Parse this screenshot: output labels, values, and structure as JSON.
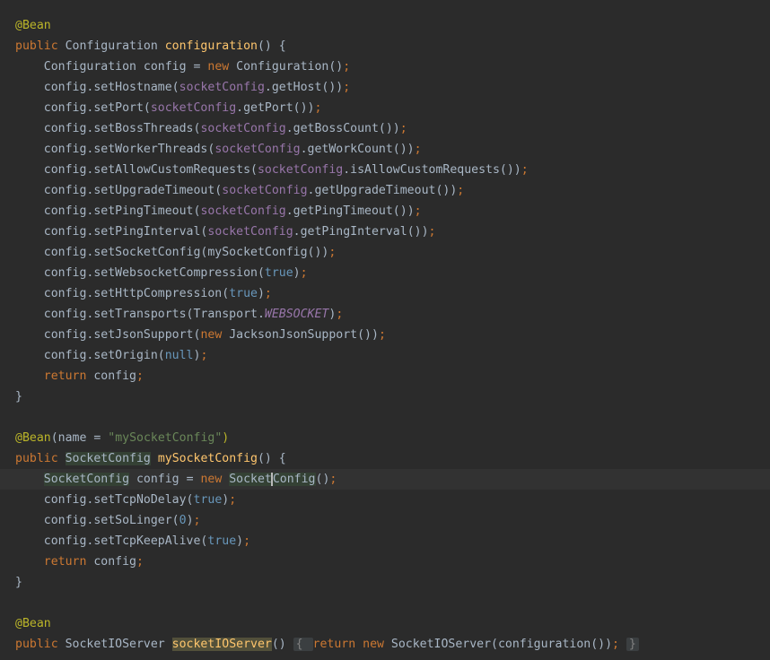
{
  "editor": {
    "lines": [
      [
        {
          "t": "@Bean",
          "c": "ann"
        }
      ],
      [
        {
          "t": "public ",
          "c": "kw"
        },
        {
          "t": "Configuration ",
          "c": "plain"
        },
        {
          "t": "configuration",
          "c": "fn"
        },
        {
          "t": "() {",
          "c": "plain"
        }
      ],
      [
        {
          "t": "    Configuration config = ",
          "c": "plain"
        },
        {
          "t": "new ",
          "c": "kw"
        },
        {
          "t": "Configuration",
          "c": "plain"
        },
        {
          "t": "()",
          "c": "plain"
        },
        {
          "t": ";",
          "c": "kw"
        }
      ],
      [
        {
          "t": "    config.setHostname(",
          "c": "plain"
        },
        {
          "t": "socketConfig",
          "c": "fld"
        },
        {
          "t": ".getHost())",
          "c": "plain"
        },
        {
          "t": ";",
          "c": "kw"
        }
      ],
      [
        {
          "t": "    config.setPort(",
          "c": "plain"
        },
        {
          "t": "socketConfig",
          "c": "fld"
        },
        {
          "t": ".getPort())",
          "c": "plain"
        },
        {
          "t": ";",
          "c": "kw"
        }
      ],
      [
        {
          "t": "    config.setBossThreads(",
          "c": "plain"
        },
        {
          "t": "socketConfig",
          "c": "fld"
        },
        {
          "t": ".getBossCount())",
          "c": "plain"
        },
        {
          "t": ";",
          "c": "kw"
        }
      ],
      [
        {
          "t": "    config.setWorkerThreads(",
          "c": "plain"
        },
        {
          "t": "socketConfig",
          "c": "fld"
        },
        {
          "t": ".getWorkCount())",
          "c": "plain"
        },
        {
          "t": ";",
          "c": "kw"
        }
      ],
      [
        {
          "t": "    config.setAllowCustomRequests(",
          "c": "plain"
        },
        {
          "t": "socketConfig",
          "c": "fld"
        },
        {
          "t": ".isAllowCustomRequests())",
          "c": "plain"
        },
        {
          "t": ";",
          "c": "kw"
        }
      ],
      [
        {
          "t": "    config.setUpgradeTimeout(",
          "c": "plain"
        },
        {
          "t": "socketConfig",
          "c": "fld"
        },
        {
          "t": ".getUpgradeTimeout())",
          "c": "plain"
        },
        {
          "t": ";",
          "c": "kw"
        }
      ],
      [
        {
          "t": "    config.setPingTimeout(",
          "c": "plain"
        },
        {
          "t": "socketConfig",
          "c": "fld"
        },
        {
          "t": ".getPingTimeout())",
          "c": "plain"
        },
        {
          "t": ";",
          "c": "kw"
        }
      ],
      [
        {
          "t": "    config.setPingInterval(",
          "c": "plain"
        },
        {
          "t": "socketConfig",
          "c": "fld"
        },
        {
          "t": ".getPingInterval())",
          "c": "plain"
        },
        {
          "t": ";",
          "c": "kw"
        }
      ],
      [
        {
          "t": "    config.setSocketConfig(mySocketConfig())",
          "c": "plain"
        },
        {
          "t": ";",
          "c": "kw"
        }
      ],
      [
        {
          "t": "    config.setWebsocketCompression(",
          "c": "plain"
        },
        {
          "t": "true",
          "c": "lit"
        },
        {
          "t": ")",
          "c": "plain"
        },
        {
          "t": ";",
          "c": "kw"
        }
      ],
      [
        {
          "t": "    config.setHttpCompression(",
          "c": "plain"
        },
        {
          "t": "true",
          "c": "lit"
        },
        {
          "t": ")",
          "c": "plain"
        },
        {
          "t": ";",
          "c": "kw"
        }
      ],
      [
        {
          "t": "    config.setTransports(Transport.",
          "c": "plain"
        },
        {
          "t": "WEBSOCKET",
          "c": "const"
        },
        {
          "t": ")",
          "c": "plain"
        },
        {
          "t": ";",
          "c": "kw"
        }
      ],
      [
        {
          "t": "    config.setJsonSupport(",
          "c": "plain"
        },
        {
          "t": "new ",
          "c": "kw"
        },
        {
          "t": "JacksonJsonSupport())",
          "c": "plain"
        },
        {
          "t": ";",
          "c": "kw"
        }
      ],
      [
        {
          "t": "    config.setOrigin(",
          "c": "plain"
        },
        {
          "t": "null",
          "c": "lit"
        },
        {
          "t": ")",
          "c": "plain"
        },
        {
          "t": ";",
          "c": "kw"
        }
      ],
      [
        {
          "t": "    ",
          "c": "plain"
        },
        {
          "t": "return ",
          "c": "kw"
        },
        {
          "t": "config",
          "c": "plain"
        },
        {
          "t": ";",
          "c": "kw"
        }
      ],
      [
        {
          "t": "}",
          "c": "plain"
        }
      ],
      [],
      [
        {
          "t": "@Bean",
          "c": "ann"
        },
        {
          "t": "(",
          "c": "plain"
        },
        {
          "t": "name",
          "c": "plain"
        },
        {
          "t": " = ",
          "c": "plain"
        },
        {
          "t": "\"mySocketConfig\"",
          "c": "str"
        },
        {
          "t": ")",
          "c": "ann"
        }
      ],
      [
        {
          "t": "public ",
          "c": "kw"
        },
        {
          "t": "SocketConfig",
          "c": "plain",
          "h": "green"
        },
        {
          "t": " ",
          "c": "plain"
        },
        {
          "t": "mySocketConfig",
          "c": "fn"
        },
        {
          "t": "() {",
          "c": "plain"
        }
      ],
      [
        {
          "t": "    ",
          "c": "plain"
        },
        {
          "t": "SocketConfig",
          "c": "plain",
          "h": "green"
        },
        {
          "t": " config = ",
          "c": "plain"
        },
        {
          "t": "new ",
          "c": "kw"
        },
        {
          "t": "Socket",
          "c": "plain",
          "h": "green"
        },
        {
          "t": "",
          "c": "plain",
          "caret": true
        },
        {
          "t": "Config",
          "c": "plain",
          "h": "green"
        },
        {
          "t": "()",
          "c": "plain"
        },
        {
          "t": ";",
          "c": "kw"
        }
      ],
      [
        {
          "t": "    config.setTcpNoDelay(",
          "c": "plain"
        },
        {
          "t": "true",
          "c": "lit"
        },
        {
          "t": ")",
          "c": "plain"
        },
        {
          "t": ";",
          "c": "kw"
        }
      ],
      [
        {
          "t": "    config.setSoLinger(",
          "c": "plain"
        },
        {
          "t": "0",
          "c": "num"
        },
        {
          "t": ")",
          "c": "plain"
        },
        {
          "t": ";",
          "c": "kw"
        }
      ],
      [
        {
          "t": "    config.setTcpKeepAlive(",
          "c": "plain"
        },
        {
          "t": "true",
          "c": "lit"
        },
        {
          "t": ")",
          "c": "plain"
        },
        {
          "t": ";",
          "c": "kw"
        }
      ],
      [
        {
          "t": "    ",
          "c": "plain"
        },
        {
          "t": "return ",
          "c": "kw"
        },
        {
          "t": "config",
          "c": "plain"
        },
        {
          "t": ";",
          "c": "kw"
        }
      ],
      [
        {
          "t": "}",
          "c": "plain"
        }
      ],
      [],
      [
        {
          "t": "@Bean",
          "c": "ann"
        }
      ],
      [
        {
          "t": "public ",
          "c": "kw"
        },
        {
          "t": "SocketIOServer ",
          "c": "plain"
        },
        {
          "t": "socketIOServer",
          "c": "fn",
          "h": "yellow"
        },
        {
          "t": "() ",
          "c": "plain"
        },
        {
          "t": "{ ",
          "c": "plain",
          "h": "fold"
        },
        {
          "t": "return ",
          "c": "kw"
        },
        {
          "t": "new ",
          "c": "kw"
        },
        {
          "t": "SocketIOServer(configuration())",
          "c": "plain"
        },
        {
          "t": "; ",
          "c": "kw"
        },
        {
          "t": "}",
          "c": "plain",
          "h": "fold"
        }
      ]
    ],
    "current_line": 22
  }
}
